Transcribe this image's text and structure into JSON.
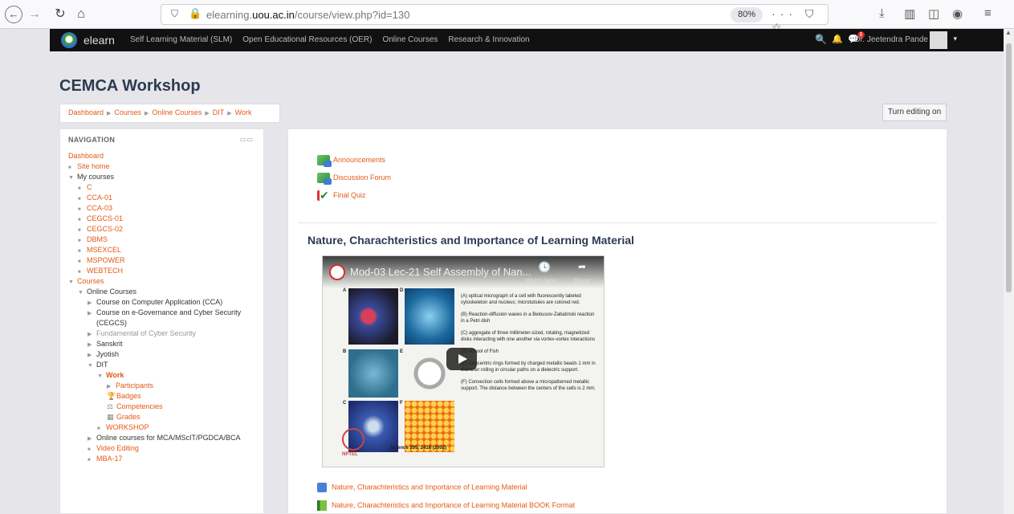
{
  "browser": {
    "url_prefix": "elearning.",
    "url_domain": "uou.ac.in",
    "url_path": "/course/view.php?id=130",
    "zoom": "80%",
    "page_actions": "··· ⛉ ☆"
  },
  "site_nav": {
    "brand": "elearn",
    "menu": [
      "Self Learning Material (SLM)",
      "Open Educational Resources (OER)",
      "Online Courses",
      "Research & Innovation"
    ],
    "message_count": "8",
    "user_name": "Dr. Jeetendra Pande"
  },
  "header": {
    "title": "CEMCA Workshop",
    "breadcrumb": [
      "Dashboard",
      "Courses",
      "Online Courses",
      "DIT",
      "Work"
    ],
    "edit_button": "Turn editing on"
  },
  "navigation": {
    "title": "NAVIGATION",
    "items": [
      {
        "label": "Dashboard",
        "indent": 0,
        "marker": "",
        "style": ""
      },
      {
        "label": "Site home",
        "indent": 0,
        "marker": "bullet",
        "style": ""
      },
      {
        "label": "My courses",
        "indent": 0,
        "marker": "open",
        "style": "dark"
      },
      {
        "label": "C",
        "indent": 1,
        "marker": "bullet",
        "style": ""
      },
      {
        "label": "CCA-01",
        "indent": 1,
        "marker": "bullet",
        "style": ""
      },
      {
        "label": "CCA-03",
        "indent": 1,
        "marker": "bullet",
        "style": ""
      },
      {
        "label": "CEGCS-01",
        "indent": 1,
        "marker": "bullet",
        "style": ""
      },
      {
        "label": "CEGCS-02",
        "indent": 1,
        "marker": "bullet",
        "style": ""
      },
      {
        "label": "DBMS",
        "indent": 1,
        "marker": "bullet",
        "style": ""
      },
      {
        "label": "MSEXCEL",
        "indent": 1,
        "marker": "bullet",
        "style": ""
      },
      {
        "label": "MSPOWER",
        "indent": 1,
        "marker": "bullet",
        "style": ""
      },
      {
        "label": "WEBTECH",
        "indent": 1,
        "marker": "bullet",
        "style": ""
      },
      {
        "label": "Courses",
        "indent": 0,
        "marker": "open",
        "style": ""
      },
      {
        "label": "Online Courses",
        "indent": 1,
        "marker": "open",
        "style": "dark"
      },
      {
        "label": "Course on Computer Application (CCA)",
        "indent": 2,
        "marker": "closed",
        "style": "dark"
      },
      {
        "label": "Course on e-Governance and Cyber Security",
        "indent": 2,
        "marker": "closed",
        "style": "dark"
      },
      {
        "label": "(CEGCS)",
        "indent": 2,
        "marker": "",
        "style": "dark"
      },
      {
        "label": "Fundamental of Cyber Security",
        "indent": 2,
        "marker": "closed",
        "style": "muted"
      },
      {
        "label": "Sanskrit",
        "indent": 2,
        "marker": "closed",
        "style": "dark"
      },
      {
        "label": "Jyotish",
        "indent": 2,
        "marker": "closed",
        "style": "dark"
      },
      {
        "label": "DIT",
        "indent": 2,
        "marker": "open",
        "style": "dark"
      },
      {
        "label": "Work",
        "indent": 3,
        "marker": "open",
        "style": "bold"
      },
      {
        "label": "Participants",
        "indent": 4,
        "marker": "closed",
        "style": ""
      },
      {
        "label": "Badges",
        "indent": 4,
        "marker": "icon-trophy",
        "style": ""
      },
      {
        "label": "Competencies",
        "indent": 4,
        "marker": "icon-scale",
        "style": ""
      },
      {
        "label": "Grades",
        "indent": 4,
        "marker": "icon-table",
        "style": ""
      },
      {
        "label": "WORKSHOP",
        "indent": 3,
        "marker": "bullet",
        "style": ""
      },
      {
        "label": "Online courses for MCA/MScIT/PGDCA/BCA",
        "indent": 2,
        "marker": "closed",
        "style": "dark"
      },
      {
        "label": "Video Editing",
        "indent": 2,
        "marker": "bullet",
        "style": ""
      },
      {
        "label": "MBA-17",
        "indent": 2,
        "marker": "bullet",
        "style": ""
      }
    ]
  },
  "main": {
    "activities": [
      {
        "label": "Announcements",
        "icon": "forum-icon"
      },
      {
        "label": "Discussion Forum",
        "icon": "forum-icon"
      },
      {
        "label": "Final Quiz",
        "icon": "quiz-icon"
      }
    ],
    "section_title": "Nature, Charachteristics and Importance of Learning Material",
    "video": {
      "title": "Mod-03 Lec-21 Self Assembly of Nan...",
      "watch_later": "Watch later",
      "share": "Share",
      "labels": [
        "A",
        "D",
        "B",
        "E",
        "C",
        "F"
      ],
      "captions": [
        "(A) optical micrograph of a cell with fluorescently labeled cytoskeleton and nucleus; microtubules are colored red.",
        "(B) Reaction-diffusion waves in a Belousov-Zabatinski reaction in a Petri dish",
        "(C) aggregate of three millimeter-sized, rotating, magnetized disks interacting with one another via vortex-vortex interactions",
        "(D) school of Fish",
        "(E) Concentric rings formed by charged metallic beads 1 mm in diameter rolling in circular paths on a dielectric support.",
        "(F) Convection cells formed above a micropatterned metallic support. The distance between the centers of the cells is 2 mm."
      ],
      "citation": "Science 295, 2418 (2002)",
      "channel": "NPTEL"
    },
    "resources": [
      {
        "label": "Nature, Charachteristics and Importance of Learning Material",
        "icon": "page-icon"
      },
      {
        "label": "Nature, Charachteristics and Importance of Learning Material BOOK Format",
        "icon": "book-icon"
      }
    ]
  }
}
